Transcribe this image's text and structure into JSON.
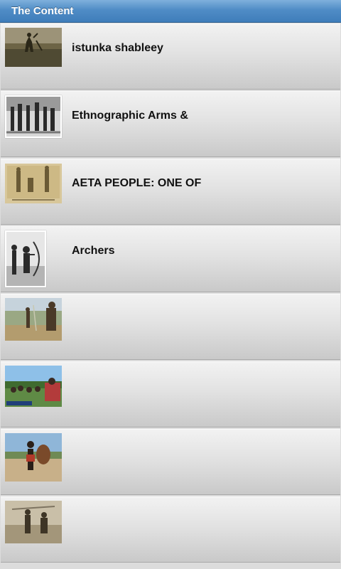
{
  "header": {
    "title": "The Content"
  },
  "items": [
    {
      "title": "istunka shableey",
      "thumb": "sepia-photo-icon"
    },
    {
      "title": "Ethnographic Arms &",
      "thumb": "bw-group-photo-icon"
    },
    {
      "title": "AETA PEOPLE: ONE OF",
      "thumb": "engraving-photo-icon"
    },
    {
      "title": "Archers",
      "thumb": "archer-photo-icon"
    },
    {
      "title": "",
      "thumb": "color-photo-icon"
    },
    {
      "title": "",
      "thumb": "crowd-photo-icon"
    },
    {
      "title": "",
      "thumb": "warrior-photo-icon"
    },
    {
      "title": "",
      "thumb": "vintage-photo-icon"
    }
  ]
}
